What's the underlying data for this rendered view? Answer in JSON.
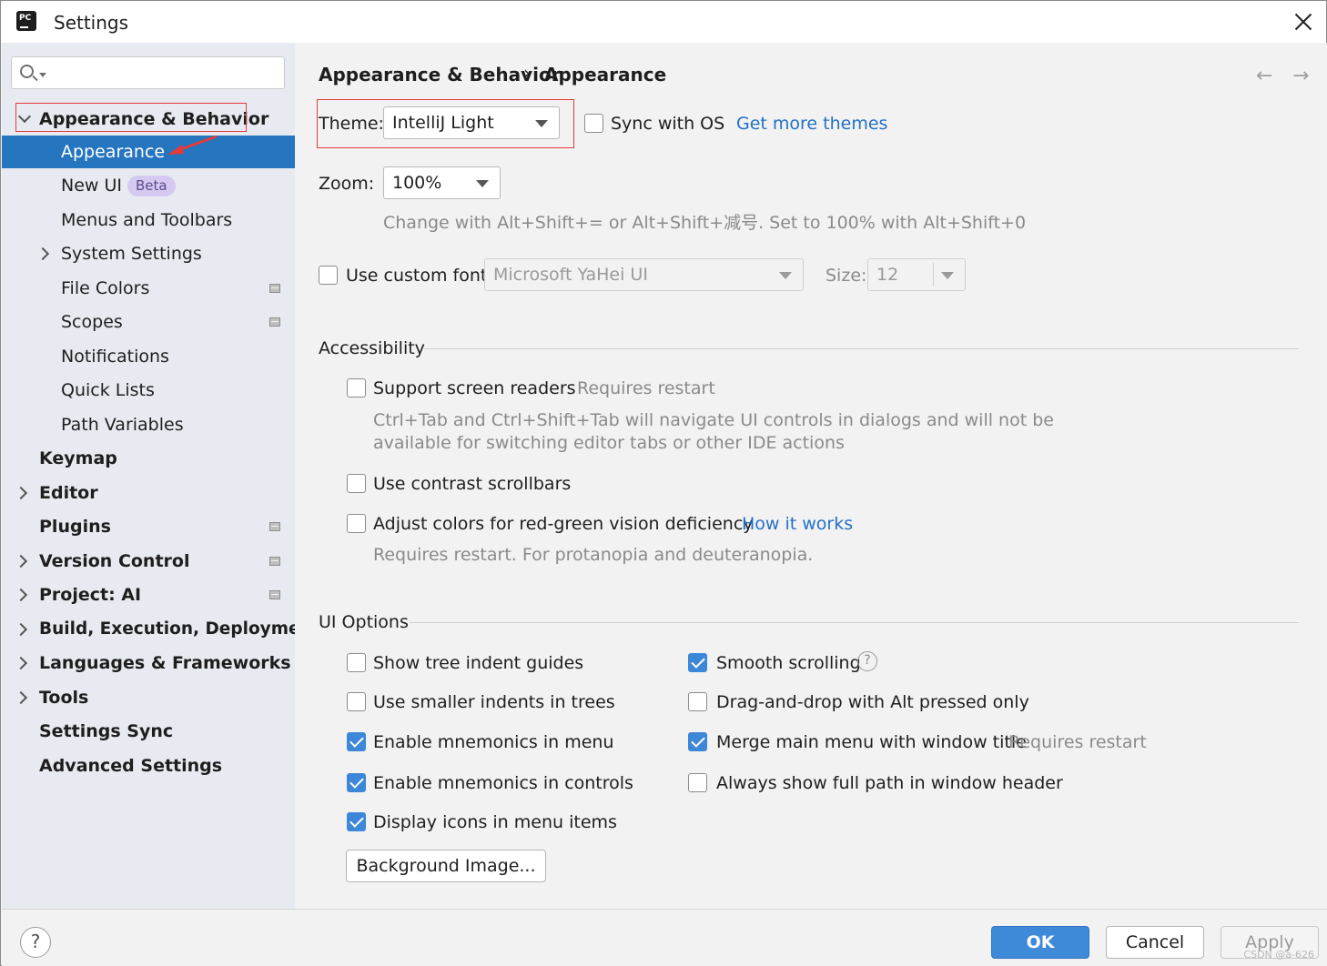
{
  "window": {
    "title": "Settings"
  },
  "sidebar": {
    "search_placeholder": "",
    "items": [
      {
        "label": "Appearance & Behavior"
      },
      {
        "label": "Appearance"
      },
      {
        "label": "New UI",
        "badge": "Beta"
      },
      {
        "label": "Menus and Toolbars"
      },
      {
        "label": "System Settings"
      },
      {
        "label": "File Colors"
      },
      {
        "label": "Scopes"
      },
      {
        "label": "Notifications"
      },
      {
        "label": "Quick Lists"
      },
      {
        "label": "Path Variables"
      },
      {
        "label": "Keymap"
      },
      {
        "label": "Editor"
      },
      {
        "label": "Plugins"
      },
      {
        "label": "Version Control"
      },
      {
        "label": "Project: AI"
      },
      {
        "label": "Build, Execution, Deployment"
      },
      {
        "label": "Languages & Frameworks"
      },
      {
        "label": "Tools"
      },
      {
        "label": "Settings Sync"
      },
      {
        "label": "Advanced Settings"
      }
    ]
  },
  "breadcrumb": {
    "parent": "Appearance & Behavior",
    "separator": "›",
    "current": "Appearance"
  },
  "nav": {
    "back": "←",
    "forward": "→"
  },
  "theme": {
    "label": "Theme:",
    "value": "IntelliJ Light",
    "sync_label": "Sync with OS",
    "sync_checked": false,
    "more_link": "Get more themes"
  },
  "zoom": {
    "label": "Zoom:",
    "value": "100%",
    "hint": "Change with Alt+Shift+= or Alt+Shift+减号. Set to 100% with Alt+Shift+0"
  },
  "custom_font": {
    "label": "Use custom font:",
    "checked": false,
    "value": "Microsoft YaHei UI",
    "size_label": "Size:",
    "size_value": "12"
  },
  "accessibility": {
    "title": "Accessibility",
    "screen_readers": {
      "label": "Support screen readers",
      "checked": false,
      "note": "Requires restart",
      "desc1": "Ctrl+Tab and Ctrl+Shift+Tab will navigate UI controls in dialogs and will not be",
      "desc2": "available for switching editor tabs or other IDE actions"
    },
    "contrast": {
      "label": "Use contrast scrollbars",
      "checked": false
    },
    "colors": {
      "label": "Adjust colors for red-green vision deficiency",
      "checked": false,
      "link": "How it works",
      "note": "Requires restart. For protanopia and deuteranopia."
    }
  },
  "ui_options": {
    "title": "UI Options",
    "left": [
      {
        "label": "Show tree indent guides",
        "checked": false
      },
      {
        "label": "Use smaller indents in trees",
        "checked": false
      },
      {
        "label": "Enable mnemonics in menu",
        "checked": true
      },
      {
        "label": "Enable mnemonics in controls",
        "checked": true
      },
      {
        "label": "Display icons in menu items",
        "checked": true
      }
    ],
    "right": [
      {
        "label": "Smooth scrolling",
        "checked": true
      },
      {
        "label": "Drag-and-drop with Alt pressed only",
        "checked": false
      },
      {
        "label": "Merge main menu with window title",
        "checked": true,
        "note": "Requires restart"
      },
      {
        "label": "Always show full path in window header",
        "checked": false
      }
    ],
    "help_glyph": "?",
    "background_button": "Background Image..."
  },
  "footer": {
    "help": "?",
    "ok": "OK",
    "cancel": "Cancel",
    "apply": "Apply",
    "watermark": "CSDN @a-626"
  },
  "colors": {
    "accent": "#2675bf",
    "checkbox_on": "#3d87d9",
    "link": "#2470c7",
    "highlight": "#e23b3b"
  }
}
